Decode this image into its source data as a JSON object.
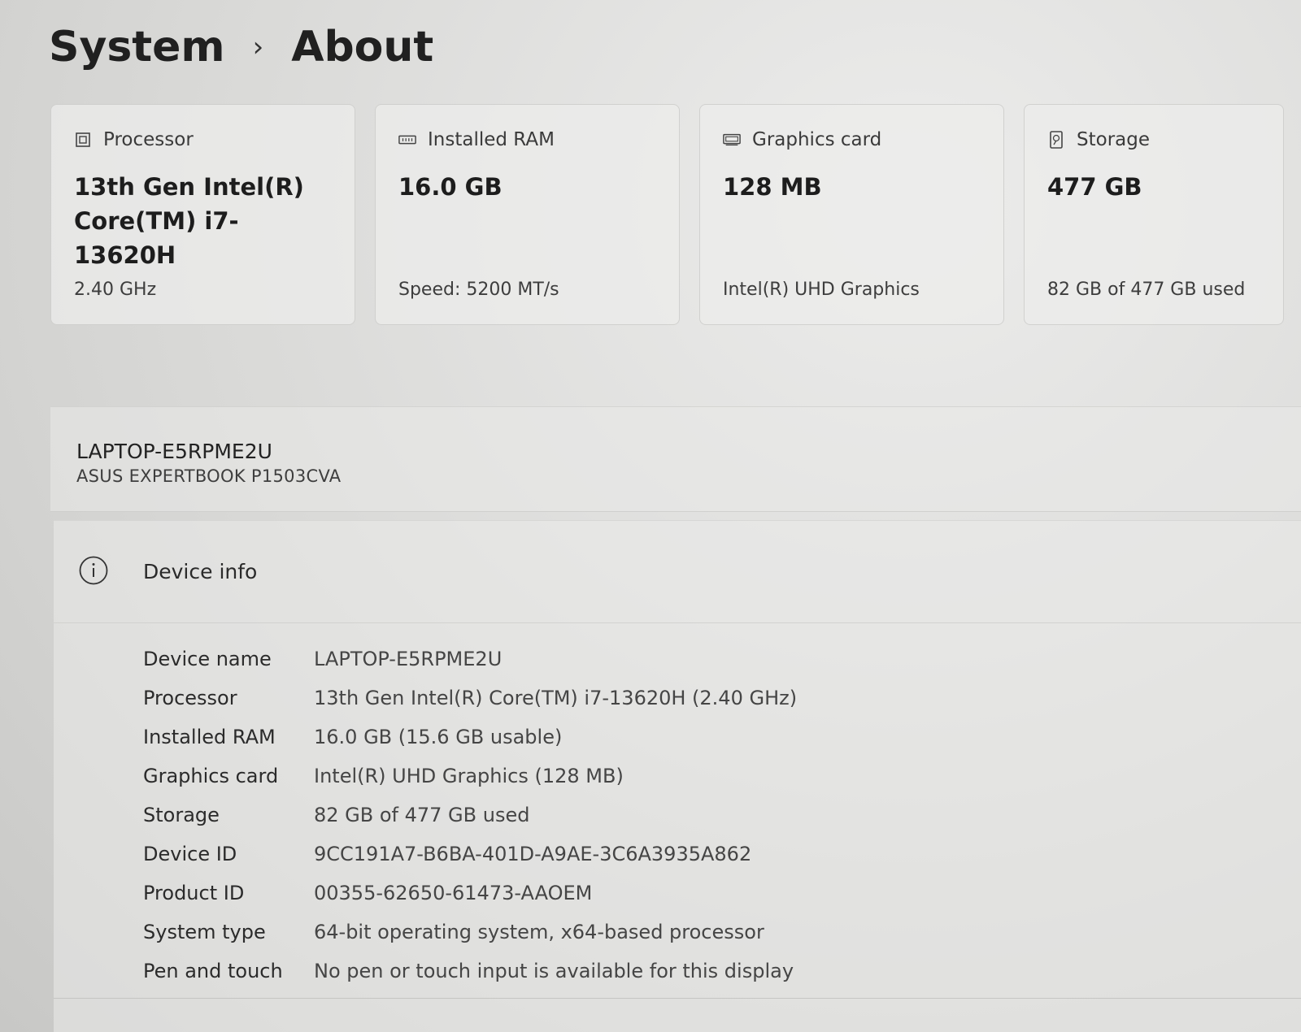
{
  "breadcrumb": {
    "parent": "System",
    "separator": "›",
    "current": "About"
  },
  "cards": [
    {
      "icon": "processor-icon",
      "label": "Processor",
      "value": "13th Gen Intel(R) Core(TM) i7-13620H",
      "sub": "2.40 GHz"
    },
    {
      "icon": "ram-icon",
      "label": "Installed RAM",
      "value": "16.0 GB",
      "sub": "Speed: 5200 MT/s"
    },
    {
      "icon": "graphics-card-icon",
      "label": "Graphics card",
      "value": "128 MB",
      "sub": "Intel(R) UHD Graphics"
    },
    {
      "icon": "storage-icon",
      "label": "Storage",
      "value": "477 GB",
      "sub": "82 GB of 477 GB used"
    }
  ],
  "device": {
    "name": "LAPTOP-E5RPME2U",
    "model": "ASUS EXPERTBOOK P1503CVA"
  },
  "device_info": {
    "icon": "info-icon",
    "title": "Device info",
    "rows": [
      {
        "label": "Device name",
        "value": "LAPTOP-E5RPME2U"
      },
      {
        "label": "Processor",
        "value": "13th Gen Intel(R) Core(TM) i7-13620H (2.40 GHz)"
      },
      {
        "label": "Installed RAM",
        "value": "16.0 GB (15.6 GB usable)"
      },
      {
        "label": "Graphics card",
        "value": "Intel(R) UHD Graphics (128 MB)"
      },
      {
        "label": "Storage",
        "value": "82 GB of 477 GB used"
      },
      {
        "label": "Device ID",
        "value": "9CC191A7-B6BA-401D-A9AE-3C6A3935A862"
      },
      {
        "label": "Product ID",
        "value": "00355-62650-61473-AAOEM"
      },
      {
        "label": "System type",
        "value": "64-bit operating system, x64-based processor"
      },
      {
        "label": "Pen and touch",
        "value": "No pen or touch input is available for this display"
      }
    ]
  }
}
